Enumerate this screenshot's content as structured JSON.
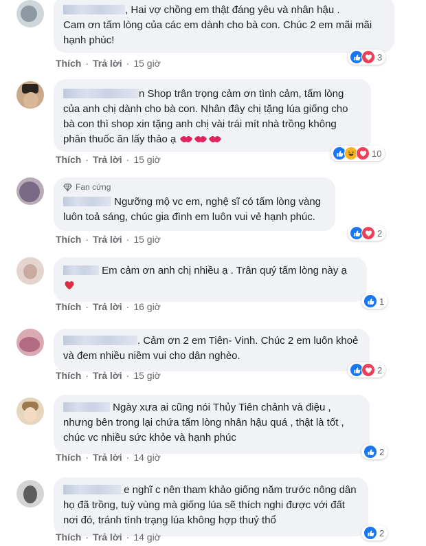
{
  "comments": [
    {
      "text": ", Hai vợ chồng em thật đáng yêu và nhân hậu .\nCam ơn tấm lòng của các em dành cho bà con. Chúc 2 em mãi mãi hạnh phúc!",
      "reactions": [
        "like-icon",
        "love-icon"
      ],
      "reaction_count": "3",
      "like_label": "Thích",
      "reply_label": "Trả lời",
      "time": "15 giờ"
    },
    {
      "text": "n Shop trân trọng cảm ơn tình cảm, tấm lòng của anh chị dành cho bà con. Nhân đây chị tặng lúa giống cho bà con thì shop xin tặng anh chị vài trái mít nhà trồng không phân thuốc ăn lấy thảo ạ",
      "emojis": [
        "kiss-icon",
        "kiss-icon",
        "kiss-icon"
      ],
      "reactions": [
        "like-icon",
        "haha-icon",
        "love-icon"
      ],
      "reaction_count": "10",
      "like_label": "Thích",
      "reply_label": "Trả lời",
      "time": "15 giờ"
    },
    {
      "badge": "Fan cứng",
      "text": "Ngưỡng mộ vc em, nghệ sĩ có tấm lòng vàng luôn toả sáng, chúc gia đình em luôn vui vẻ hạnh phúc.",
      "reactions": [
        "like-icon",
        "love-icon"
      ],
      "reaction_count": "2",
      "like_label": "Thích",
      "reply_label": "Trả lời",
      "time": "15 giờ"
    },
    {
      "text": "Em cảm ơn anh chị nhiều ạ . Trân quý tấm lòng này ạ",
      "emojis": [
        "heart-icon"
      ],
      "reactions": [
        "like-icon"
      ],
      "reaction_count": "1",
      "like_label": "Thích",
      "reply_label": "Trả lời",
      "time": "16 giờ"
    },
    {
      "text": "Cảm ơn 2 em Tiên- Vinh. Chúc 2 em luôn khoẻ và đem nhiều niềm vui cho dân nghèo.",
      "reactions": [
        "like-icon",
        "love-icon"
      ],
      "reaction_count": "2",
      "like_label": "Thích",
      "reply_label": "Trả lời",
      "time": "15 giờ"
    },
    {
      "text": "Ngày xưa ai cũng nói Thủy Tiên chảnh và điệu , nhưng bên trong lại chứa tấm lòng nhân hậu quá , thật là tốt , chúc vc nhiều sức khỏe và hạnh phúc",
      "reactions": [
        "like-icon"
      ],
      "reaction_count": "2",
      "like_label": "Thích",
      "reply_label": "Trả lời",
      "time": "14 giờ"
    },
    {
      "text": "e nghĩ c nên tham khảo giống năm trước nông dân họ đã trồng, tuỳ vùng mà giống lúa sẽ thích nghi được với đất nơi đó, tránh tình trạng lúa không hợp thuỷ thổ",
      "reactions": [
        "like-icon"
      ],
      "reaction_count": "2",
      "like_label": "Thích",
      "reply_label": "Trả lời",
      "time": "14 giờ"
    }
  ],
  "colors": {
    "bubble_bg": "#f0f2f5",
    "text": "#1c1e21",
    "meta": "#65676b",
    "like_blue": "#1877f2",
    "love_red": "#f33e58",
    "haha_yellow": "#f7b125"
  }
}
